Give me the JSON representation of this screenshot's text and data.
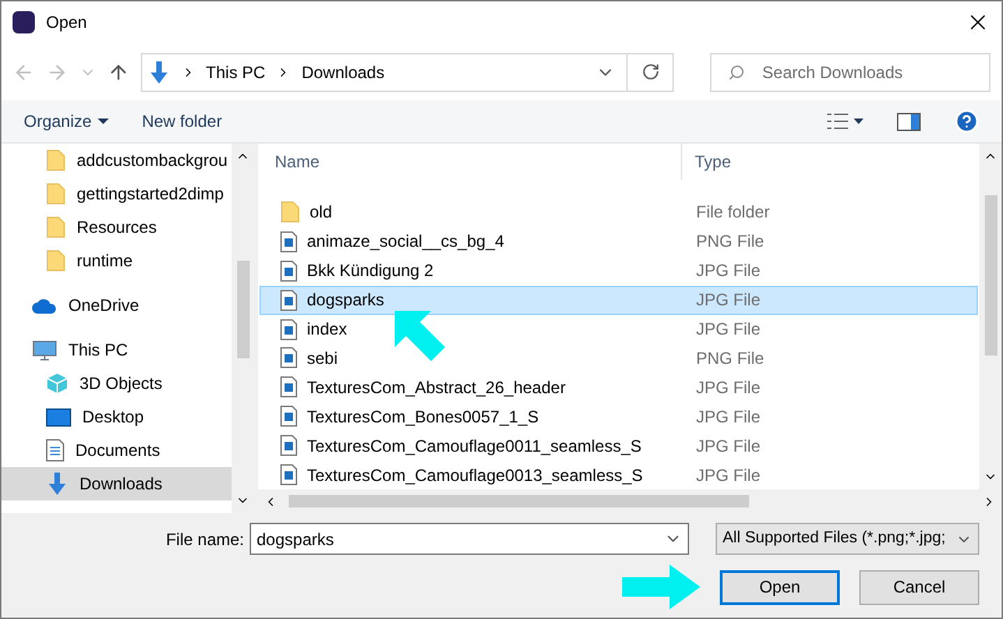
{
  "window": {
    "title": "Open"
  },
  "address": {
    "path": [
      "This PC",
      "Downloads"
    ],
    "search_placeholder": "Search Downloads"
  },
  "toolbar": {
    "organize": "Organize",
    "new_folder": "New folder"
  },
  "sidebar": {
    "sections": [
      {
        "children": [
          {
            "label": "addcustombackgrou",
            "kind": "folder",
            "selected": false
          },
          {
            "label": "gettingstarted2dimp",
            "kind": "folder",
            "selected": false
          },
          {
            "label": "Resources",
            "kind": "folder",
            "selected": false
          },
          {
            "label": "runtime",
            "kind": "folder",
            "selected": false
          }
        ]
      },
      {
        "label": "OneDrive",
        "kind": "onedrive",
        "selected": false
      },
      {
        "label": "This PC",
        "kind": "pc",
        "selected": false,
        "children": [
          {
            "label": "3D Objects",
            "kind": "objects3d",
            "selected": false
          },
          {
            "label": "Desktop",
            "kind": "desktop",
            "selected": false
          },
          {
            "label": "Documents",
            "kind": "documents",
            "selected": false
          },
          {
            "label": "Downloads",
            "kind": "downloads",
            "selected": true
          }
        ]
      }
    ]
  },
  "table": {
    "columns": [
      "Name",
      "Type"
    ],
    "rows": [
      {
        "name": "old",
        "type": "File folder",
        "kind": "folder",
        "selected": false
      },
      {
        "name": "animaze_social__cs_bg_4",
        "type": "PNG File",
        "kind": "image",
        "selected": false
      },
      {
        "name": "Bkk Kündigung 2",
        "type": "JPG File",
        "kind": "image",
        "selected": false
      },
      {
        "name": "dogsparks",
        "type": "JPG File",
        "kind": "image",
        "selected": true
      },
      {
        "name": "index",
        "type": "JPG File",
        "kind": "image",
        "selected": false
      },
      {
        "name": "sebi",
        "type": "PNG File",
        "kind": "image",
        "selected": false
      },
      {
        "name": "TexturesCom_Abstract_26_header",
        "type": "JPG File",
        "kind": "image",
        "selected": false
      },
      {
        "name": "TexturesCom_Bones0057_1_S",
        "type": "JPG File",
        "kind": "image",
        "selected": false
      },
      {
        "name": "TexturesCom_Camouflage0011_seamless_S",
        "type": "JPG File",
        "kind": "image",
        "selected": false
      },
      {
        "name": "TexturesCom_Camouflage0013_seamless_S",
        "type": "JPG File",
        "kind": "image",
        "selected": false
      }
    ]
  },
  "footer": {
    "file_name_label": "File name:",
    "file_name": "dogsparks",
    "file_type": "All Supported Files (*.png;*.jpg;",
    "buttons": [
      {
        "label": "Open",
        "default": true
      },
      {
        "label": "Cancel",
        "default": false
      }
    ]
  }
}
